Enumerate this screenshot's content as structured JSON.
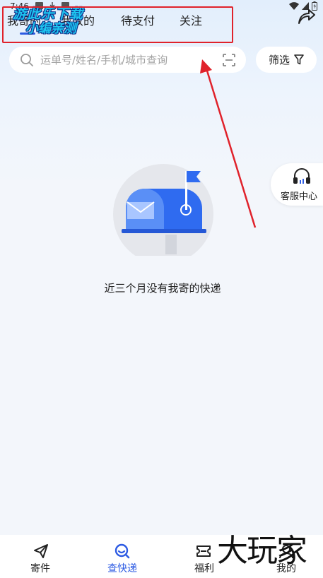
{
  "status_bar": {
    "time": "7:46"
  },
  "top_tabs": [
    {
      "label": "我寄的",
      "active": true
    },
    {
      "label": "我收的",
      "active": false
    },
    {
      "label": "待支付",
      "active": false
    },
    {
      "label": "关注",
      "active": false
    }
  ],
  "watermark": {
    "line1": "游此乐下载",
    "line2": "小编亲测"
  },
  "search": {
    "placeholder": "运单号/姓名/手机/城市查询",
    "value": ""
  },
  "filter": {
    "label": "筛选"
  },
  "service_center": {
    "label": "客服中心"
  },
  "empty_state": {
    "message": "近三个月没有我寄的快递"
  },
  "bottom_nav": [
    {
      "label": "寄件",
      "icon": "paper-plane-icon",
      "active": false
    },
    {
      "label": "查快递",
      "icon": "search-package-icon",
      "active": true
    },
    {
      "label": "福利",
      "icon": "gift-icon",
      "active": false
    },
    {
      "label": "我的",
      "icon": "profile-icon",
      "active": false
    }
  ],
  "corner_logo": "大玩家",
  "colors": {
    "accent": "#2d5be3",
    "annotation_red": "#e0222b",
    "watermark_cyan": "#1ec5f0"
  }
}
